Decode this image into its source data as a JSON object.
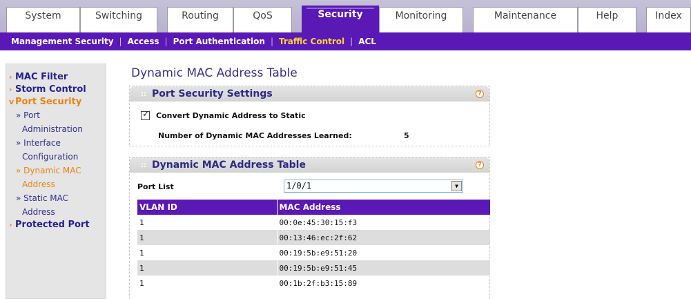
{
  "top_tabs": [
    "System",
    "Switching",
    "Routing",
    "QoS",
    "Security",
    "Monitoring",
    "Maintenance",
    "Help",
    "Index"
  ],
  "active_top_tab": "Security",
  "sub_nav": [
    "Management Security",
    "Access",
    "Port Authentication",
    "Traffic Control",
    "ACL"
  ],
  "active_sub_nav": "Traffic Control",
  "left_nav": {
    "mac_filter": "MAC Filter",
    "storm_control": "Storm Control",
    "port_security": "Port Security",
    "port_admin_1": "» Port",
    "port_admin_2": "Administration",
    "interface_config_1": "» Interface",
    "interface_config_2": "Configuration",
    "dynamic_mac_1": "» Dynamic MAC",
    "dynamic_mac_2": "Address",
    "static_mac_1": "» Static MAC",
    "static_mac_2": "Address",
    "protected_port": "Protected Port"
  },
  "page_title": "Dynamic MAC Address Table",
  "port_security_settings": {
    "heading": "Port Security Settings",
    "convert_label": "Convert Dynamic Address to Static",
    "convert_checked": true,
    "learned_label": "Number of Dynamic MAC Addresses Learned:",
    "learned_value": "5"
  },
  "mac_table_panel": {
    "heading": "Dynamic MAC Address Table",
    "port_list_label": "Port List",
    "port_list_value": "1/0/1",
    "columns": [
      "VLAN ID",
      "MAC Address"
    ],
    "rows": [
      [
        "1",
        "00:0e:45:30:15:f3"
      ],
      [
        "1",
        "00:13:46:ec:2f:62"
      ],
      [
        "1",
        "00:19:5b:e9:51:20"
      ],
      [
        "1",
        "00:19:5b:e9:51:45"
      ],
      [
        "1",
        "00:1b:2f:b3:15:89"
      ]
    ]
  },
  "icons": {
    "help": "help-icon",
    "dropdown": "chevron-down-icon",
    "nav_marker": "chevron-right-icon",
    "nav_marker_open": "chevron-down-icon"
  },
  "colors": {
    "accent": "#5a18b4",
    "highlight": "#ffd23a",
    "nav_active": "#e68413",
    "nav_link": "#231f8b"
  },
  "help_glyph": "?",
  "nav_marker_glyph": "›",
  "nav_marker_open_glyph": "v",
  "head_dots": "::",
  "dropdown_glyph": "▼"
}
